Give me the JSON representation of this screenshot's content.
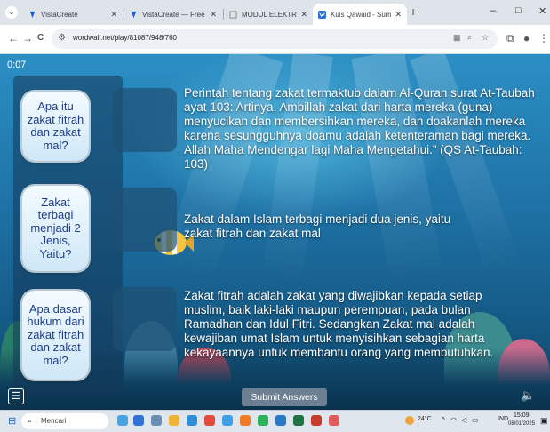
{
  "browser": {
    "tab_menu_icon": "chevron-down-icon",
    "tabs": [
      {
        "title": "VistaCreate",
        "favicon_color": "#1b5ad7"
      },
      {
        "title": "VistaCreate — Free Graphic De",
        "favicon_color": "#1b5ad7"
      },
      {
        "title": "MODUL ELEKTRONIK",
        "favicon_color": "#e8eaed"
      },
      {
        "title": "Kuis Qawaid - Sumber pengaj",
        "favicon_color": "#2f73d8"
      }
    ],
    "new_tab": "+",
    "window_controls": [
      "–",
      "□",
      "✕"
    ],
    "url": "wordwall.net/play/81087/948/760",
    "nav": {
      "back": "←",
      "forward": "→",
      "reload": "C"
    }
  },
  "game": {
    "timer": "0:07",
    "questions": [
      "Apa itu zakat fitrah dan zakat mal?",
      "Zakat terbagi menjadi 2 Jenis, Yaitu?",
      "Apa dasar hukum dari zakat fitrah dan zakat mal?"
    ],
    "answers": [
      "Perintah tentang zakat termaktub dalam Al-Quran surat At-Taubah ayat 103: Artinya, Ambillah zakat dari harta mereka (guna) menyucikan dan membersihkan mereka, dan doakanlah mereka karena sesungguhnya doamu adalah ketenteraman bagi mereka. Allah Maha Mendengar lagi Maha Mengetahui.” (QS At-Taubah: 103)",
      "Zakat dalam Islam terbagi menjadi dua jenis, yaitu zakat fitrah dan zakat mal",
      "Zakat fitrah adalah zakat yang diwajibkan kepada setiap muslim, baik laki-laki maupun perempuan, pada bulan Ramadhan dan Idul Fitri. Sedangkan Zakat mal adalah kewajiban umat Islam untuk menyisihkan sebagian harta kekayaannya untuk membantu orang yang membutuhkan."
    ],
    "submit_label": "Submit Answers",
    "menu_icon": "menu-icon",
    "sound_icon": "speaker-icon"
  },
  "taskbar": {
    "search_placeholder": "Mencari",
    "weather": "24°C",
    "lang": "IND",
    "time": "15:09",
    "date": "08/01/2025"
  }
}
